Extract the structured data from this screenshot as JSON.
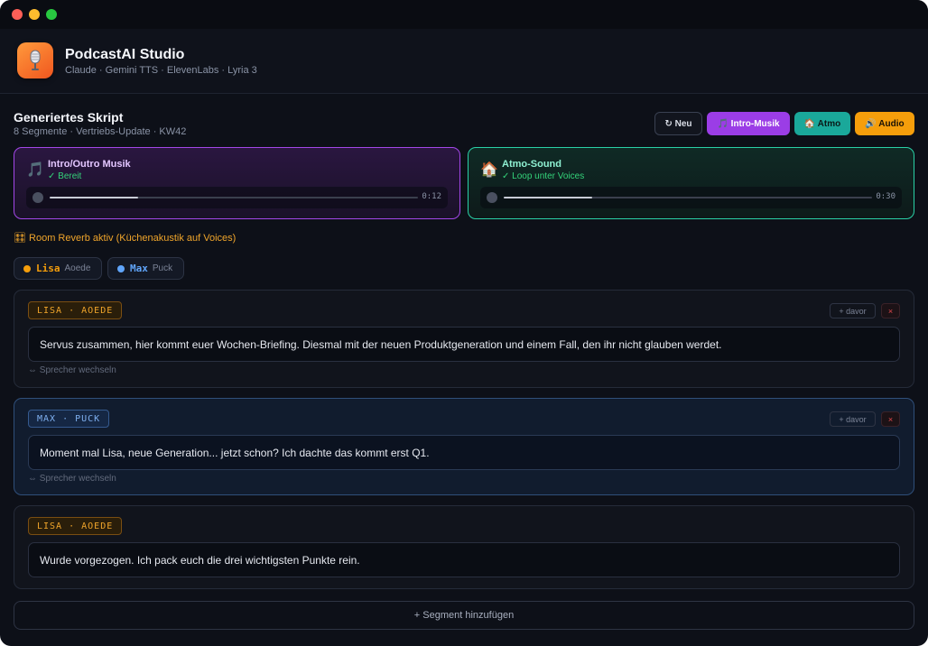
{
  "app": {
    "title": "PodcastAI Studio",
    "subtitle": "Claude · Gemini TTS · ElevenLabs · Lyria 3",
    "icon": "microphone-icon"
  },
  "script": {
    "title": "Generiertes Skript",
    "subtitle": "8 Segmente · Vertriebs-Update · KW42"
  },
  "toolbar": {
    "new_label": "↻ Neu",
    "intro_label": "🎵 Intro-Musik",
    "atmo_label": "🏠 Atmo",
    "audio_label": "🔊 Audio"
  },
  "audio_cards": {
    "music": {
      "emoji": "🎵",
      "title": "Intro/Outro Musik",
      "status": "✓ Bereit",
      "time": "0:12",
      "progress": 0.24
    },
    "atmo": {
      "emoji": "🏠",
      "title": "Atmo-Sound",
      "status": "✓ Loop unter Voices",
      "time": "0:30",
      "progress": 0.24
    }
  },
  "reverb_text": "🎛 Room Reverb aktiv (Küchenakustik auf Voices)",
  "speakers": [
    {
      "name": "Lisa",
      "voice": "Aoede",
      "color": "#f59e0b"
    },
    {
      "name": "Max",
      "voice": "Puck",
      "color": "#60a5fa"
    }
  ],
  "segments": [
    {
      "tag": "LISA · AOEDE",
      "text": "Servus zusammen, hier kommt euer Wochen-Briefing. Diesmal mit der neuen Produktgeneration und einem Fall, den ihr nicht glauben werdet.",
      "add_label": "+ davor",
      "delete_label": "×",
      "switch_label": "⇔ Sprecher wechseln"
    },
    {
      "tag": "MAX · PUCK",
      "text": "Moment mal Lisa, neue Generation... jetzt schon? Ich dachte das kommt erst Q1.",
      "add_label": "+ davor",
      "delete_label": "×",
      "switch_label": "⇔ Sprecher wechseln"
    },
    {
      "tag": "LISA · AOEDE",
      "text": "Wurde vorgezogen. Ich pack euch die drei wichtigsten Punkte rein."
    }
  ],
  "add_segment_label": "+ Segment hinzufügen",
  "colors": {
    "lisa": "#f59e0b",
    "max": "#60a5fa",
    "music_border": "#a347e8",
    "atmo_border": "#2ad1a7"
  }
}
